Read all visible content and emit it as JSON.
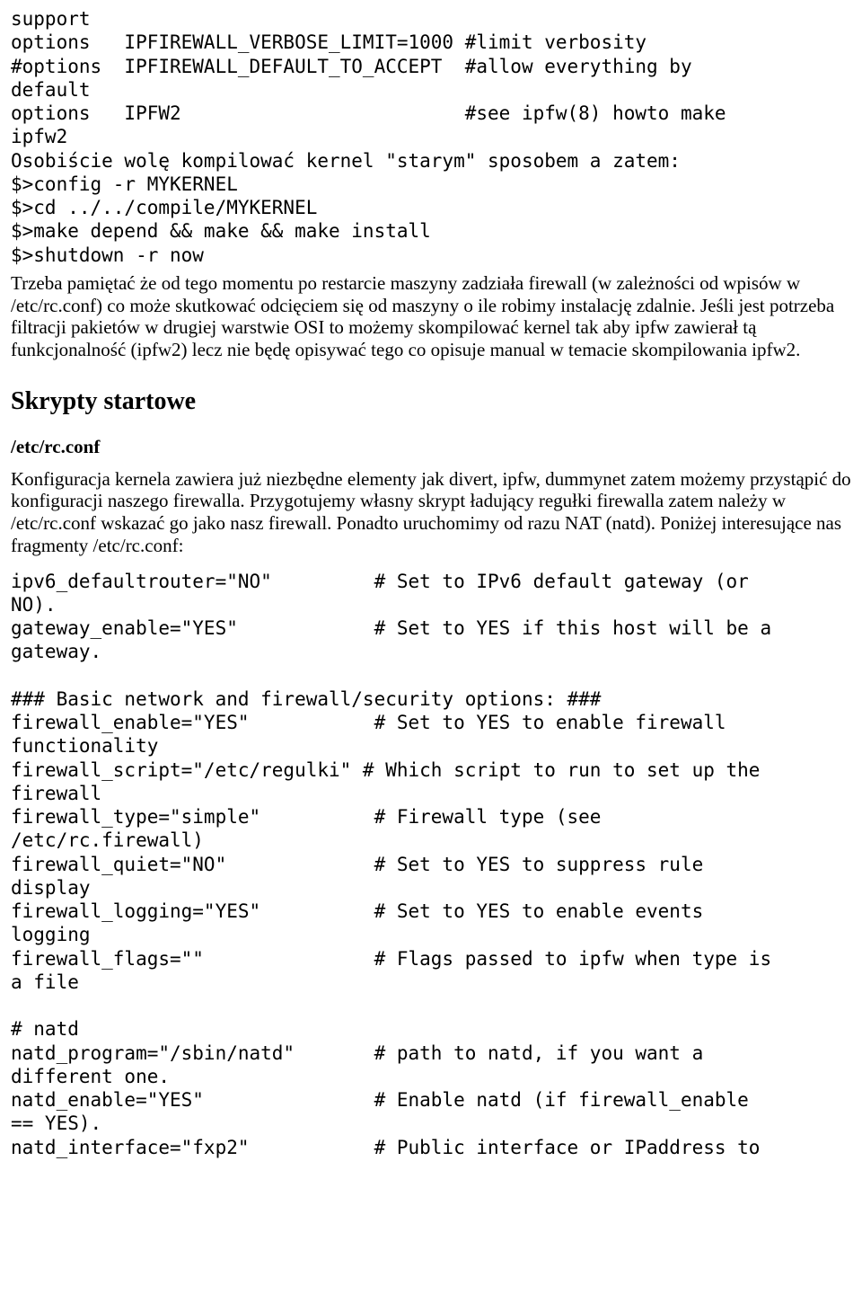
{
  "code1": "support\noptions   IPFIREWALL_VERBOSE_LIMIT=1000 #limit verbosity\n#options  IPFIREWALL_DEFAULT_TO_ACCEPT  #allow everything by\ndefault\noptions   IPFW2                         #see ipfw(8) howto make\nipfw2",
  "code2_pre": "Osobiście wolę kompilować kernel \"starym\" sposobem a zatem:",
  "code2": "$>config -r MYKERNEL\n$>cd ../../compile/MYKERNEL\n$>make depend && make && make install\n$>shutdown -r now",
  "para1": "Trzeba pamiętać że od tego momentu po restarcie maszyny zadziała firewall (w zależności od wpisów w /etc/rc.conf) co może skutkować odcięciem się od maszyny o ile robimy instalację zdalnie. Jeśli jest potrzeba filtracji pakietów w drugiej warstwie OSI to możemy skompilować kernel tak aby ipfw zawierał tą funkcjonalność (ipfw2) lecz nie będę opisywać tego co opisuje manual w temacie skompilowania ipfw2.",
  "h2": "Skrypty startowe",
  "sub": "/etc/rc.conf",
  "para2": "Konfiguracja kernela zawiera już niezbędne elementy jak divert, ipfw, dummynet zatem możemy przystąpić do konfiguracji naszego firewalla. Przygotujemy własny skrypt ładujący regułki firewalla zatem należy w /etc/rc.conf wskazać go jako nasz firewall. Ponadto uruchomimy od razu NAT (natd). Poniżej interesujące nas fragmenty /etc/rc.conf:",
  "code3": "ipv6_defaultrouter=\"NO\"         # Set to IPv6 default gateway (or\nNO).\ngateway_enable=\"YES\"            # Set to YES if this host will be a\ngateway.\n\n### Basic network and firewall/security options: ###\nfirewall_enable=\"YES\"           # Set to YES to enable firewall\nfunctionality\nfirewall_script=\"/etc/regulki\" # Which script to run to set up the\nfirewall\nfirewall_type=\"simple\"          # Firewall type (see\n/etc/rc.firewall)\nfirewall_quiet=\"NO\"             # Set to YES to suppress rule\ndisplay\nfirewall_logging=\"YES\"          # Set to YES to enable events\nlogging\nfirewall_flags=\"\"               # Flags passed to ipfw when type is\na file\n\n# natd\nnatd_program=\"/sbin/natd\"       # path to natd, if you want a\ndifferent one.\nnatd_enable=\"YES\"               # Enable natd (if firewall_enable\n== YES).\nnatd_interface=\"fxp2\"           # Public interface or IPaddress to"
}
